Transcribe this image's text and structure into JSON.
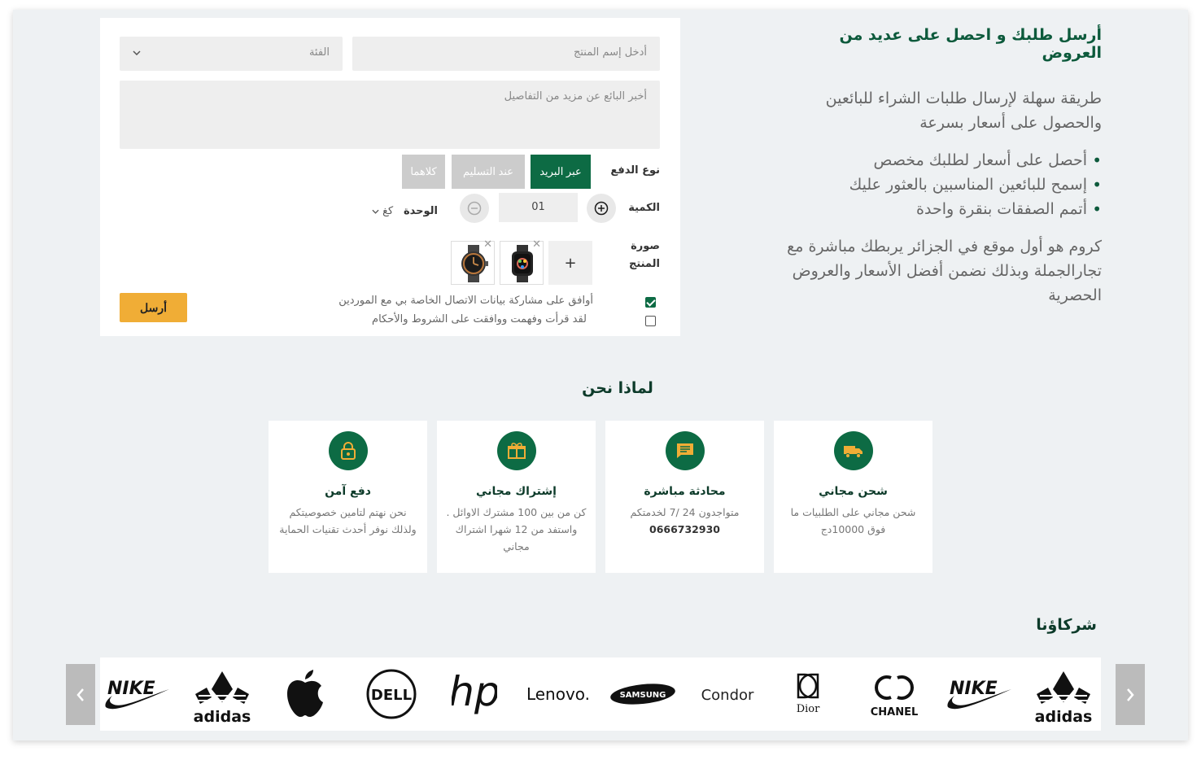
{
  "intro": {
    "title": "أرسل طلبك و احصل على عديد من العروض",
    "paragraph1": "طريقة سهلة لإرسال طلبات الشراء للبائعين والحصول على أسعار بسرعة",
    "bullets": [
      "أحصل على أسعار لطلبك مخصص",
      "إسمح للبائعين المناسبين بالعثور  عليك",
      "أتمم الصفقات بنقرة واحدة"
    ],
    "paragraph2": "كروم هو أول موقع في الجزائر يربطك مباشرة مع تجارالجملة وبذلك نضمن أفضل الأسعار والعروض الحصرية"
  },
  "form": {
    "product_name_placeholder": "أدخل إسم المنتج",
    "category_placeholder": "الفئة",
    "details_placeholder": "أخبر البائع عن مزيد من التفاصيل",
    "payment_label": "نوع الدفع",
    "payment_options": [
      "عبر البريد",
      "عند التسليم",
      "كلاهما"
    ],
    "quantity_label": "الكمية",
    "quantity_value": "01",
    "unit_label": "الوحدة",
    "unit_value": "كغ",
    "image_label": "صورة المنتج",
    "add_image": "+",
    "consent_text": "أوافق على مشاركة بيانات الاتصال الخاصة بي مع الموردين",
    "terms_text": "لقد قرأت وفهمت ووافقت على الشروط والأحكام",
    "consent_checked": true,
    "terms_checked": false,
    "send_label": "أرسل"
  },
  "why_us": {
    "title": "لماذا نحن",
    "features": [
      {
        "icon": "truck-icon",
        "title": "شحن مجاني",
        "text": "شحن مجاني على الطلبيات ما فوق 10000دج"
      },
      {
        "icon": "chat-icon",
        "title": "محادثة مباشرة",
        "text": "متواجدون 24 /7 لخدمتكم",
        "phone": "0666732930"
      },
      {
        "icon": "gift-icon",
        "title": "إشتراك مجاني",
        "text": "كن من بين 100 مشترك الاوائل . واستفد من 12 شهرا اشتراك مجاني"
      },
      {
        "icon": "lock-icon",
        "title": "دفع آمن",
        "text": "نحن نهتم لتامين خصوصيتكم ولذلك نوفر أحدث تقنيات الحماية"
      }
    ]
  },
  "partners": {
    "title": "شركاؤنا",
    "logos": [
      "NIKE",
      "adidas",
      "apple",
      "DELL",
      "hp",
      "Lenovo.",
      "SAMSUNG",
      "Condor",
      "Dior",
      "CHANEL",
      "NIKE",
      "adidas"
    ]
  },
  "colors": {
    "primary": "#0d6b44",
    "accent": "#f0ad36",
    "background": "#eef1f3"
  }
}
